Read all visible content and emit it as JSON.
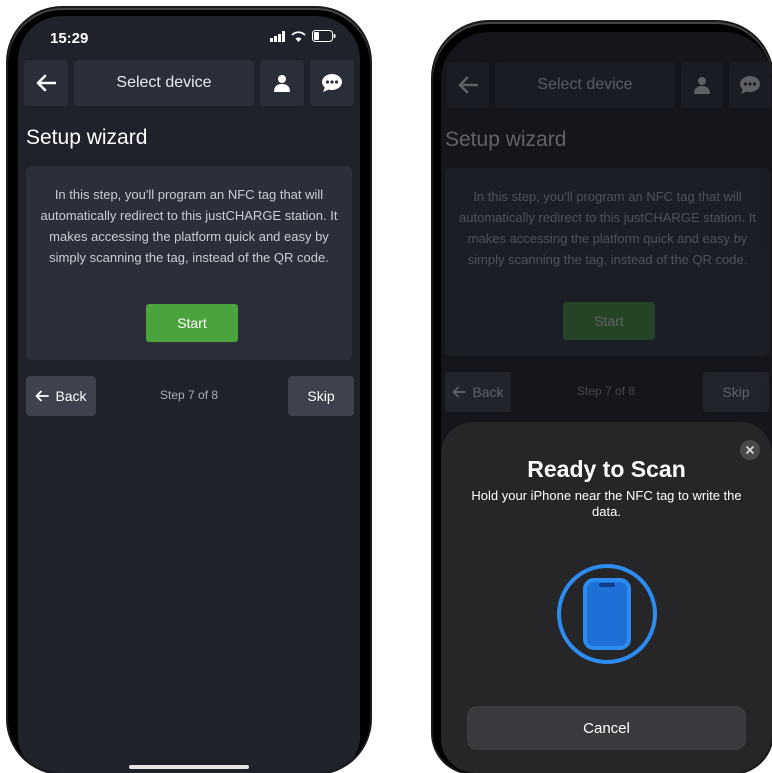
{
  "status": {
    "time": "15:29"
  },
  "header": {
    "title": "Select device"
  },
  "wizard": {
    "heading": "Setup wizard",
    "info": "In this step, you'll program an NFC tag that will automatically redirect to this justCHARGE station. It makes accessing the platform quick and easy by simply scanning the tag, instead of the QR code.",
    "start_label": "Start",
    "back_label": "Back",
    "step_text": "Step 7 of 8",
    "skip_label": "Skip"
  },
  "scan_sheet": {
    "title": "Ready to Scan",
    "message": "Hold your iPhone near the NFC tag to write the data.",
    "cancel_label": "Cancel"
  },
  "colors": {
    "background": "#1f222b",
    "card": "#2b2f39",
    "accent_green": "#4aa33c",
    "nfc_blue": "#2d8cf0"
  }
}
